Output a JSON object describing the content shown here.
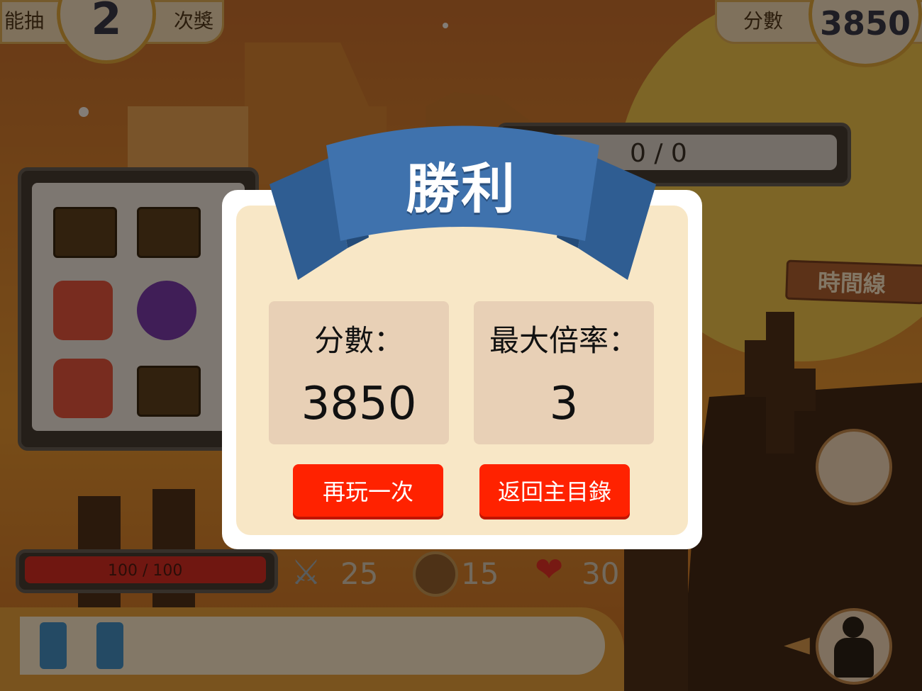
{
  "hud": {
    "draw_label": "能抽",
    "draw_count": "2",
    "draw_suffix": "次獎",
    "score_label": "分數",
    "score_value": "3850",
    "progress_text": "0 / 0",
    "timeline_label": "時間線"
  },
  "player": {
    "hp_text": "100 / 100",
    "attack": "25",
    "defense": "15",
    "health": "30"
  },
  "modal": {
    "title": "勝利",
    "score_label": "分數：",
    "score_value": "3850",
    "multiplier_label": "最大倍率：",
    "multiplier_value": "3",
    "play_again_label": "再玩一次",
    "back_to_menu_label": "返回主目錄"
  },
  "colors": {
    "ribbon": "#3f72ad",
    "button": "#ff2200",
    "panel": "#f8e7c6",
    "stat_box": "#e8d0b6"
  },
  "icons": {
    "inventory": [
      "chest-icon",
      "chest-icon",
      "ruby-gem-icon",
      "purple-gem-icon",
      "ruby-gem-icon",
      "chest-icon"
    ],
    "stats": [
      "crossed-swords-icon",
      "shield-icon",
      "heart-icon"
    ],
    "side": [
      "bat-monster-icon",
      "player-avatar-icon",
      "arrow-icon"
    ],
    "cards": [
      "blue-card-icon",
      "blue-card-icon"
    ]
  }
}
